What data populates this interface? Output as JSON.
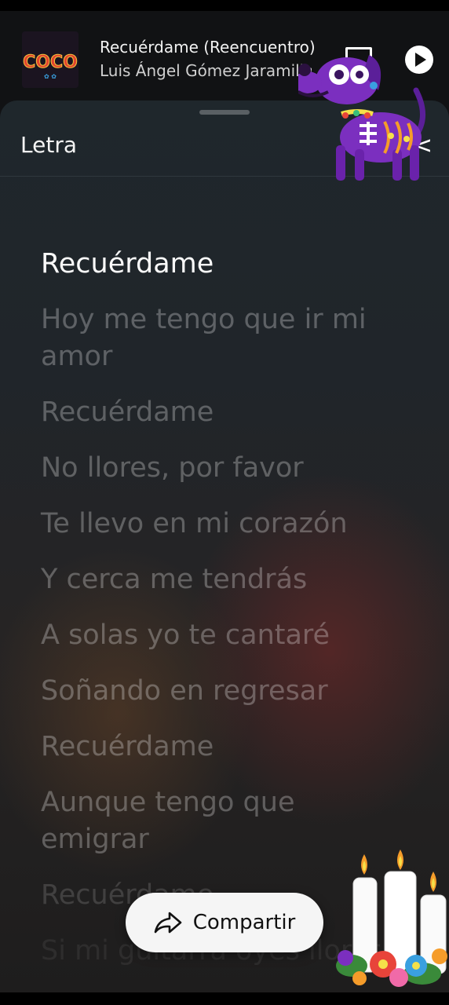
{
  "mini_player": {
    "album_art_text": "COCO",
    "title": "Recuérdame (Reencuentro)",
    "artist": "Luis Ángel Gómez Jaramillo"
  },
  "lyrics_sheet": {
    "title": "Letra",
    "close_glyph": "<",
    "lines": [
      "Recuérdame",
      "Hoy me tengo que ir mi amor",
      "Recuérdame",
      "No llores, por favor",
      "Te llevo en mi corazón",
      "Y cerca me tendrás",
      "A solas yo te cantaré",
      "Soñando en regresar",
      "Recuérdame",
      "Aunque tengo que emigrar",
      "Recuérdame",
      "Si mi guitarra oyes llorar"
    ],
    "active_index": 0
  },
  "share": {
    "label": "Compartir"
  },
  "icons": {
    "queue": "queue-icon",
    "play": "play-icon",
    "share": "share-arrow-icon",
    "close": "chevron-left-icon"
  },
  "colors": {
    "active_lyric": "#fafafa",
    "inactive_lyric": "rgba(255,255,255,0.28)",
    "sticker_purple": "#7b2fbf"
  }
}
